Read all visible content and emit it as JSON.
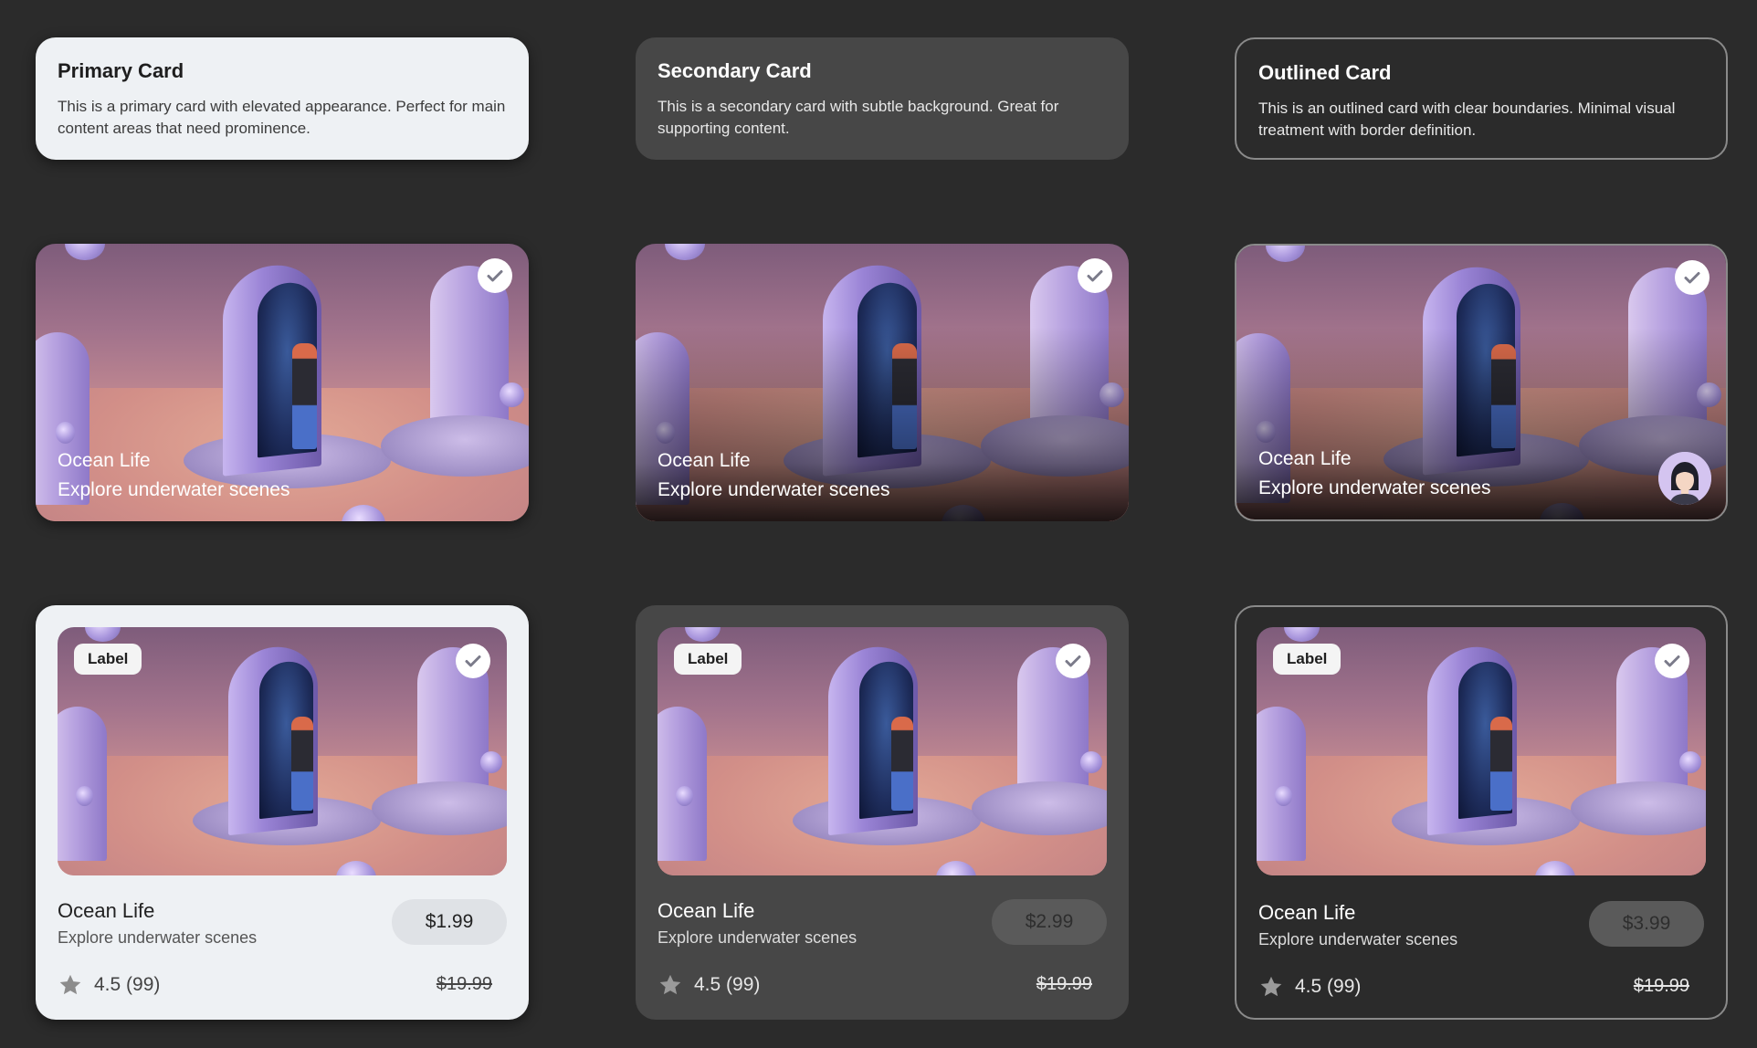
{
  "colors": {
    "background": "#2b2b2b",
    "primary_surface": "#eef1f4",
    "secondary_surface": "#474747",
    "outline": "#8a8a8a"
  },
  "text_cards": [
    {
      "title": "Primary Card",
      "description": "This is a primary card with elevated appearance. Perfect for main content areas that need prominence."
    },
    {
      "title": "Secondary Card",
      "description": "This is a secondary card with subtle background. Great for supporting content."
    },
    {
      "title": "Outlined Card",
      "description": "This is an outlined card with clear boundaries. Minimal visual treatment with border definition."
    }
  ],
  "media_cards": [
    {
      "title": "Ocean Life",
      "subtitle": "Explore underwater scenes",
      "selected_icon": "check-circle-icon"
    },
    {
      "title": "Ocean Life",
      "subtitle": "Explore underwater scenes",
      "selected_icon": "check-circle-icon"
    },
    {
      "title": "Ocean Life",
      "subtitle": "Explore underwater scenes",
      "selected_icon": "check-circle-icon",
      "avatar_icon": "avatar"
    }
  ],
  "product_cards": [
    {
      "label": "Label",
      "title": "Ocean Life",
      "subtitle": "Explore underwater scenes",
      "price": "$1.99",
      "rating": "4.5 (99)",
      "original_price": "$19.99",
      "star_icon": "star-icon"
    },
    {
      "label": "Label",
      "title": "Ocean Life",
      "subtitle": "Explore underwater scenes",
      "price": "$2.99",
      "rating": "4.5 (99)",
      "original_price": "$19.99",
      "star_icon": "star-icon"
    },
    {
      "label": "Label",
      "title": "Ocean Life",
      "subtitle": "Explore underwater scenes",
      "price": "$3.99",
      "rating": "4.5 (99)",
      "original_price": "$19.99",
      "star_icon": "star-icon"
    }
  ]
}
